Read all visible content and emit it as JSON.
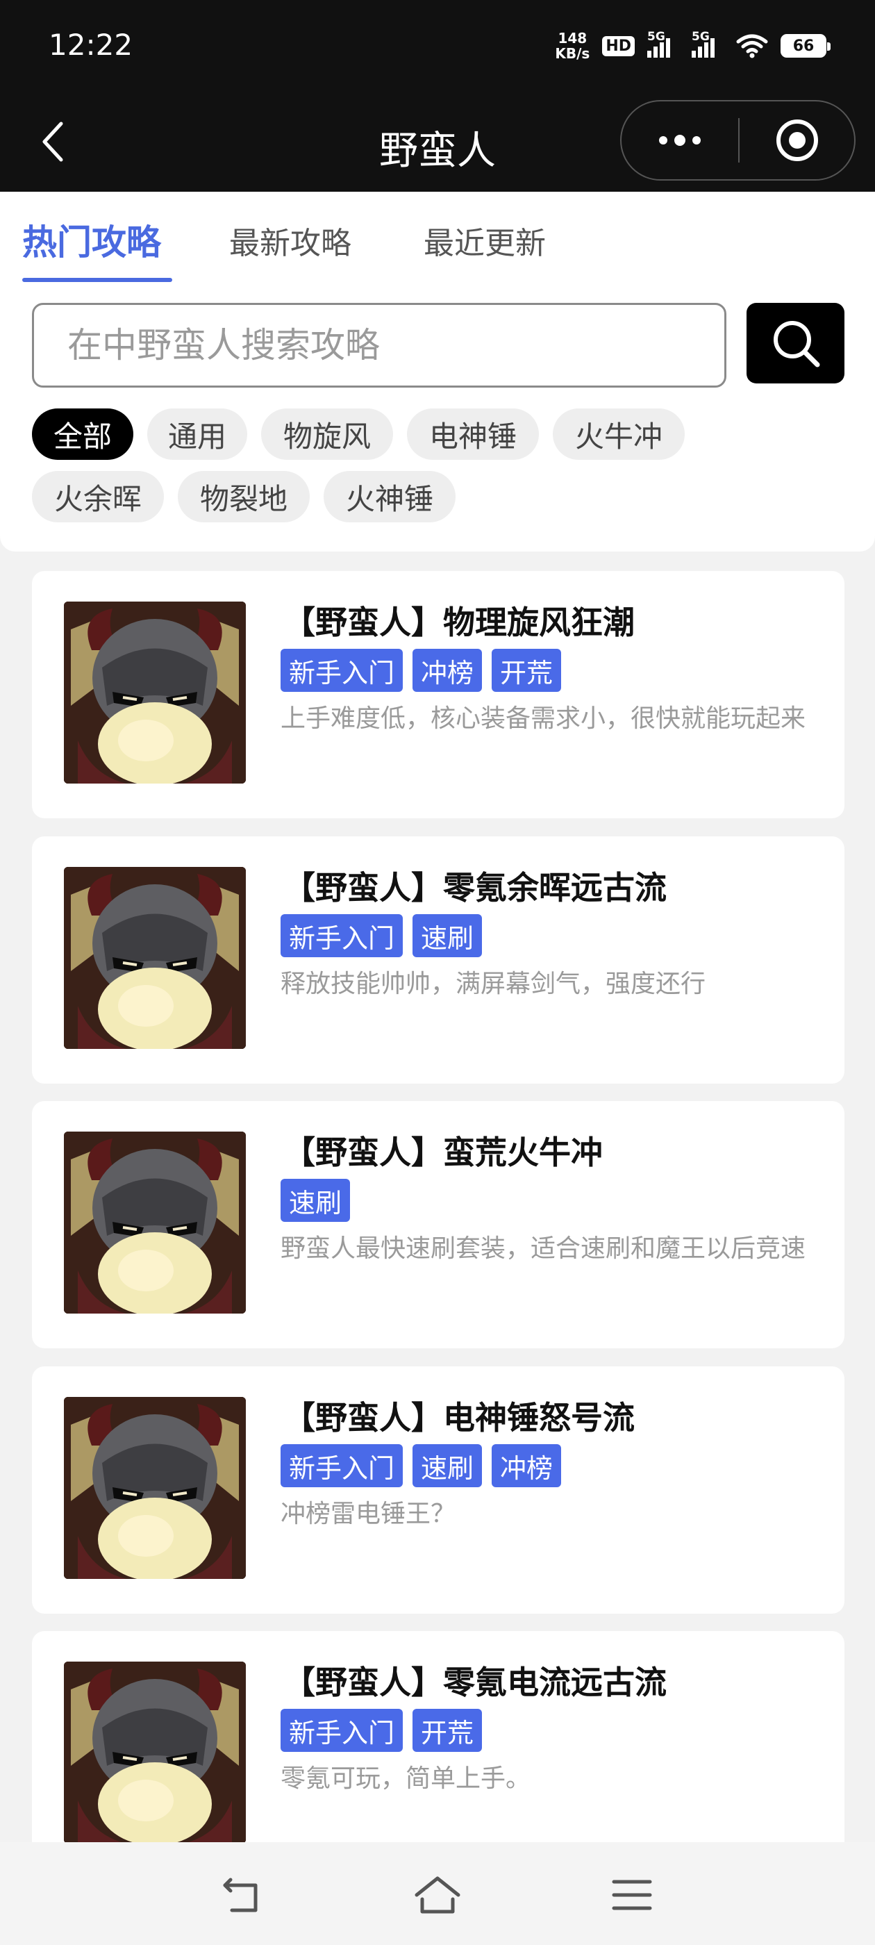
{
  "status_bar": {
    "time": "12:22",
    "net_speed_value": "148",
    "net_speed_unit": "KB/s",
    "hd_label": "HD",
    "signal_1_label": "5G",
    "signal_2_label": "5G",
    "battery_level": "66"
  },
  "nav": {
    "title": "野蛮人"
  },
  "tabs": [
    {
      "label": "热门攻略",
      "active": true
    },
    {
      "label": "最新攻略",
      "active": false
    },
    {
      "label": "最近更新",
      "active": false
    }
  ],
  "search": {
    "placeholder": "在中野蛮人搜索攻略"
  },
  "filters": [
    {
      "label": "全部",
      "active": true
    },
    {
      "label": "通用"
    },
    {
      "label": "物旋风"
    },
    {
      "label": "电神锤"
    },
    {
      "label": "火牛冲"
    },
    {
      "label": "火余晖"
    },
    {
      "label": "物裂地"
    },
    {
      "label": "火神锤"
    }
  ],
  "cards": [
    {
      "title": "【野蛮人】物理旋风狂潮",
      "tags": [
        "新手入门",
        "冲榜",
        "开荒"
      ],
      "desc": "上手难度低，核心装备需求小，很快就能玩起来"
    },
    {
      "title": "【野蛮人】零氪余晖远古流",
      "tags": [
        "新手入门",
        "速刷"
      ],
      "desc": "释放技能帅帅，满屏幕剑气，强度还行"
    },
    {
      "title": "【野蛮人】蛮荒火牛冲",
      "tags": [
        "速刷"
      ],
      "desc": "野蛮人最快速刷套装，适合速刷和魔王以后竞速"
    },
    {
      "title": "【野蛮人】电神锤怒号流",
      "tags": [
        "新手入门",
        "速刷",
        "冲榜"
      ],
      "desc": "冲榜雷电锤王？"
    },
    {
      "title": "【野蛮人】零氪电流远古流",
      "tags": [
        "新手入门",
        "开荒"
      ],
      "desc": "零氪可玩，简单上手。"
    }
  ],
  "colors": {
    "accent": "#4a6ae0",
    "tag_bg": "#4a6ae8",
    "header_bg": "#111111"
  }
}
